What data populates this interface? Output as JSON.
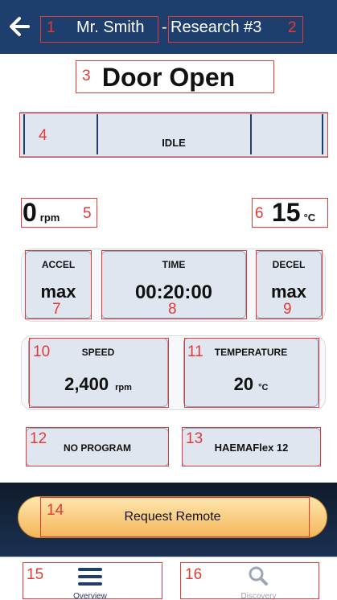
{
  "header": {
    "customer": "Mr. Smith",
    "separator": "-",
    "run_name": "Research #3"
  },
  "state_title": "Door Open",
  "status": {
    "label": "IDLE"
  },
  "current": {
    "speed_value": "0",
    "speed_unit": "rpm",
    "temp_value": "15",
    "temp_unit": "°C"
  },
  "accel": {
    "label": "ACCEL",
    "value": "max"
  },
  "time": {
    "label": "TIME",
    "value": "00:20:00"
  },
  "decel": {
    "label": "DECEL",
    "value": "max"
  },
  "speed": {
    "label": "SPEED",
    "value": "2,400",
    "unit": "rpm"
  },
  "temperature": {
    "label": "TEMPERATURE",
    "value": "20",
    "unit": "°C"
  },
  "program": {
    "label": "NO PROGRAM"
  },
  "rotor": {
    "label": "HAEMAFlex 12"
  },
  "remote_button": {
    "label": "Request Remote"
  },
  "nav": {
    "overview": {
      "label": "Overview",
      "icon": "hamburger-icon"
    },
    "discovery": {
      "label": "Discovery",
      "icon": "search-icon"
    }
  },
  "annotations": [
    "1",
    "2",
    "3",
    "4",
    "5",
    "6",
    "7",
    "8",
    "9",
    "10",
    "11",
    "12",
    "13",
    "14",
    "15",
    "16"
  ],
  "colors": {
    "header": "#1e3f6e",
    "card": "#dfe6ef",
    "annotation": "#e53935",
    "button": "#f3b65a",
    "nav_active": "#1e3f6e",
    "nav_inactive": "#9aa7b6"
  }
}
